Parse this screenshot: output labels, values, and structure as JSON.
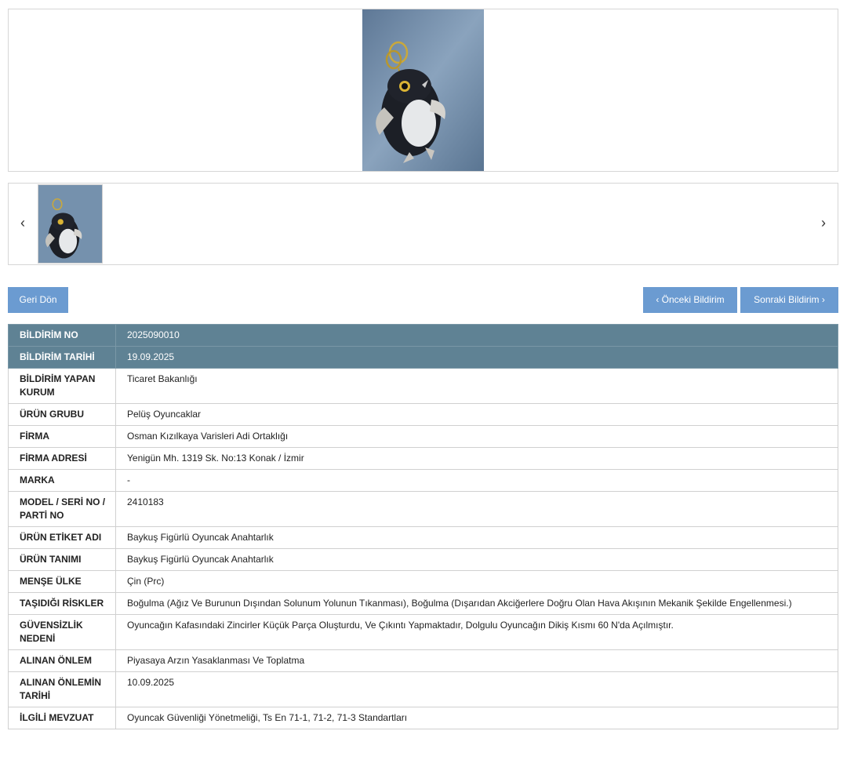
{
  "gallery": {
    "main_image": "owl-plush-keychain-photo",
    "prev_arrow": "‹",
    "next_arrow": "›",
    "thumbnails": [
      "owl-plush-keychain-thumb"
    ]
  },
  "actions": {
    "back_label": "Geri Dön",
    "prev_label": "‹ Önceki Bildirim",
    "next_label": "Sonraki Bildirim ›"
  },
  "colors": {
    "button": "#6b9bd1",
    "header_row": "#5f8294"
  },
  "details": [
    {
      "label": "BİLDİRİM NO",
      "value": "2025090010"
    },
    {
      "label": "BİLDİRİM TARİHİ",
      "value": "19.09.2025"
    },
    {
      "label": "BİLDİRİM YAPAN KURUM",
      "value": "Ticaret Bakanlığı"
    },
    {
      "label": "ÜRÜN GRUBU",
      "value": "Pelüş Oyuncaklar"
    },
    {
      "label": "FİRMA",
      "value": "Osman Kızılkaya Varisleri Adi Ortaklığı"
    },
    {
      "label": "FİRMA ADRESİ",
      "value": "Yenigün Mh. 1319 Sk. No:13 Konak / İzmir"
    },
    {
      "label": "MARKA",
      "value": "-"
    },
    {
      "label": "MODEL / SERİ NO / PARTİ NO",
      "value": "2410183"
    },
    {
      "label": "ÜRÜN ETİKET ADI",
      "value": "Baykuş Figürlü Oyuncak Anahtarlık"
    },
    {
      "label": "ÜRÜN TANIMI",
      "value": "Baykuş Figürlü Oyuncak Anahtarlık"
    },
    {
      "label": "MENŞE ÜLKE",
      "value": "Çin (Prc)"
    },
    {
      "label": "TAŞIDIĞI RİSKLER",
      "value": "Boğulma (Ağız Ve Burunun Dışından Solunum Yolunun Tıkanması), Boğulma (Dışarıdan Akciğerlere Doğru Olan Hava Akışının Mekanik Şekilde Engellenmesi.)"
    },
    {
      "label": "GÜVENSİZLİK NEDENİ",
      "value": "Oyuncağın Kafasındaki Zincirler Küçük Parça Oluşturdu, Ve Çıkıntı Yapmaktadır, Dolgulu Oyuncağın Dikiş Kısmı 60 N'da Açılmıştır."
    },
    {
      "label": "ALINAN ÖNLEM",
      "value": "Piyasaya Arzın Yasaklanması Ve Toplatma"
    },
    {
      "label": "ALINAN ÖNLEMİN TARİHİ",
      "value": "10.09.2025"
    },
    {
      "label": "İLGİLİ MEVZUAT",
      "value": "Oyuncak Güvenliği Yönetmeliği, Ts En 71-1, 71-2, 71-3 Standartları"
    }
  ]
}
